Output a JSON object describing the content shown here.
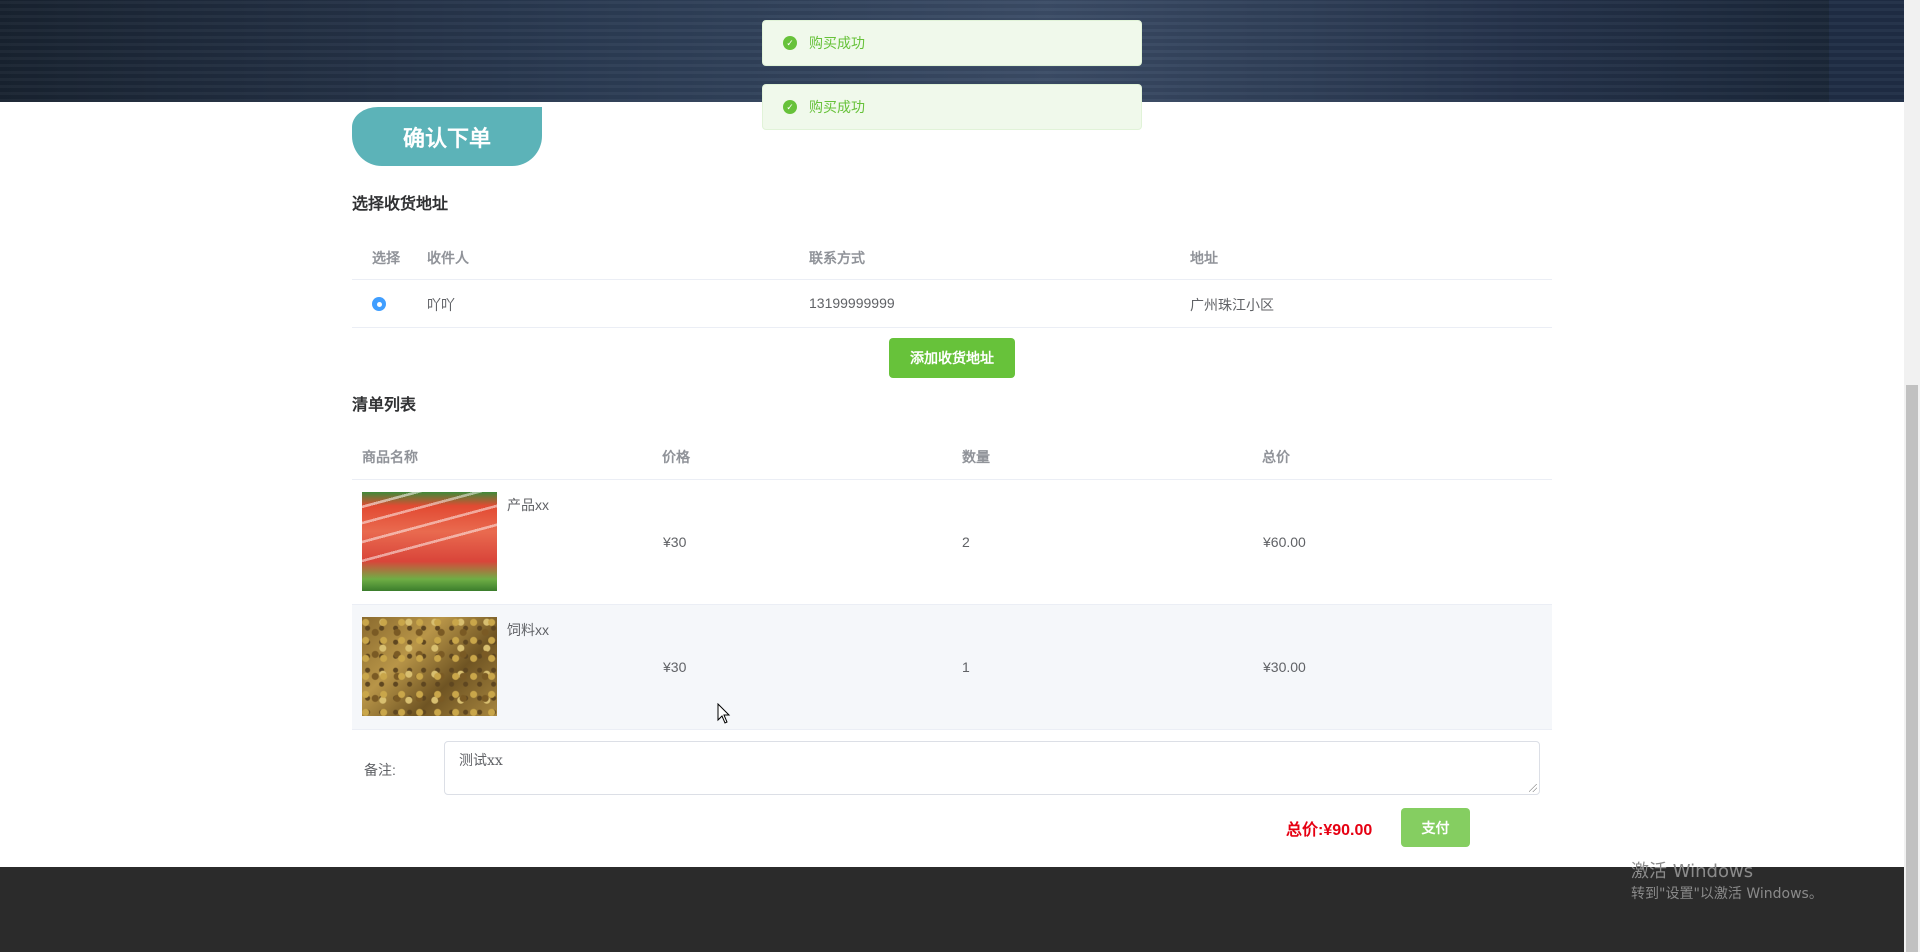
{
  "toasts": [
    {
      "text": "购买成功"
    },
    {
      "text": "购买成功"
    }
  ],
  "page": {
    "confirm_title": "确认下单"
  },
  "address": {
    "section_title": "选择收货地址",
    "headers": {
      "select": "选择",
      "recipient": "收件人",
      "contact": "联系方式",
      "address": "地址"
    },
    "rows": [
      {
        "recipient": "吖吖",
        "contact": "13199999999",
        "address": "广州珠江小区",
        "selected": true
      }
    ],
    "add_button": "添加收货地址"
  },
  "order": {
    "section_title": "清单列表",
    "headers": {
      "name": "商品名称",
      "price": "价格",
      "quantity": "数量",
      "total": "总价"
    },
    "items": [
      {
        "name": "产品xx",
        "price": "¥30",
        "quantity": "2",
        "total": "¥60.00",
        "image": "salmon-image"
      },
      {
        "name": "饲料xx",
        "price": "¥30",
        "quantity": "1",
        "total": "¥30.00",
        "image": "feed-image"
      }
    ]
  },
  "remark": {
    "label": "备注:",
    "value": "测试xx"
  },
  "summary": {
    "total_label": "总价:",
    "total_value": "¥90.00",
    "pay_button": "支付"
  },
  "watermark": {
    "line1": "激活 Windows",
    "line2": "转到\"设置\"以激活 Windows。"
  },
  "colors": {
    "accent_teal": "#5cb3b8",
    "success_green": "#67c23a",
    "price_red": "#e60012",
    "footer_dark": "#2b2b2b"
  }
}
